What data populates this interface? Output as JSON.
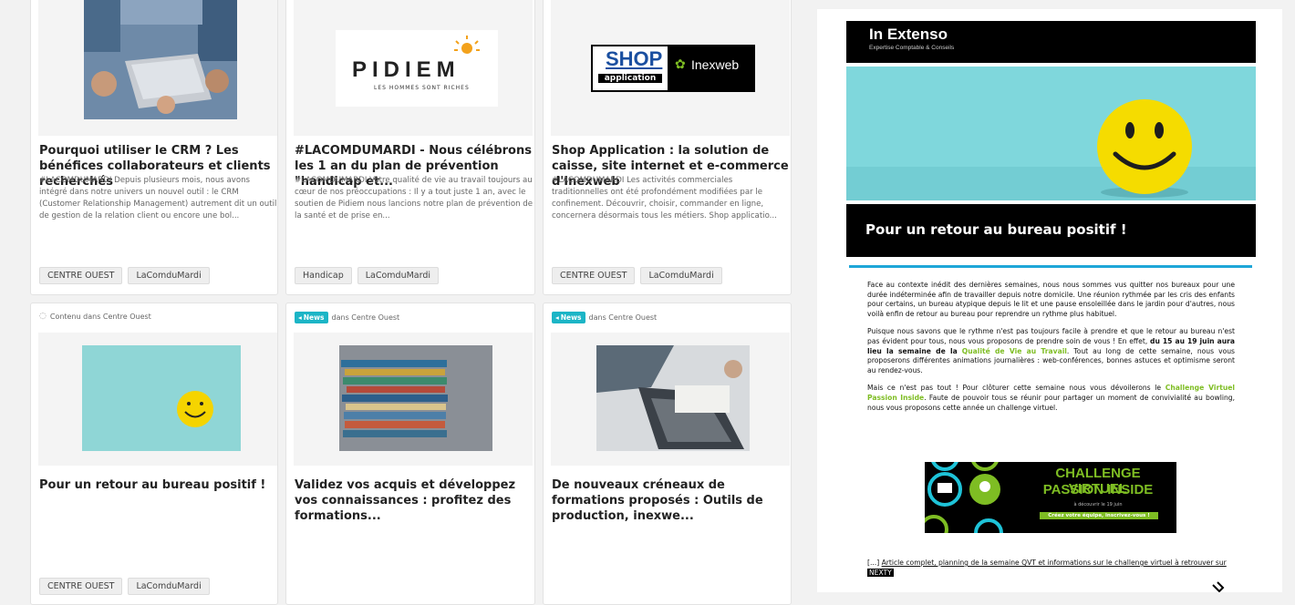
{
  "cards": [
    {
      "title": "Pourquoi utiliser le CRM ? Les bénéfices collaborateurs et clients recherchés",
      "excerpt": "#LACOMDUMARDI Depuis plusieurs mois, nous avons intégré dans notre univers un nouvel outil : le CRM (Customer Relationship Management) autrement dit un outil de gestion de la relation client ou encore une bol...",
      "tags": [
        "CENTRE OUEST",
        "LaComduMardi"
      ]
    },
    {
      "title": "#LACOMDUMARDI - Nous célébrons les 1 an du plan de prévention \"handicap et...",
      "excerpt": "#LACOMDUMARDI Votre qualité de vie au travail toujours au cœur de nos préoccupations : Il y a tout juste 1 an, avec le soutien de Pidiem nous lancions notre plan de prévention de la santé et de prise en...",
      "tags": [
        "Handicap",
        "LaComduMardi"
      ],
      "logo_text": "PIDIEM",
      "logo_subtext": "LES HOMMES SONT RICHES"
    },
    {
      "title": "Shop Application : la solution de caisse, site internet et e-commerce d'Inexweb",
      "excerpt": "#LACOMDUMARDI Les activités commerciales traditionnelles ont été profondément modifiées par le confinement. Découvrir, choisir, commander en ligne, concernera désormais tous les métiers. Shop applicatio...",
      "tags": [
        "CENTRE OUEST",
        "LaComduMardi"
      ],
      "logo_shop": "SHOP",
      "logo_application": "application",
      "logo_inexweb": "Inexweb"
    },
    {
      "meta": "Contenu dans Centre Ouest",
      "title": "Pour un retour au bureau positif !",
      "tags": [
        "CENTRE OUEST",
        "LaComduMardi"
      ]
    },
    {
      "badge": "News",
      "meta": "dans Centre Ouest",
      "title": "Validez vos acquis et développez vos connaissances : profitez des formations..."
    },
    {
      "badge": "News",
      "meta": "dans Centre Ouest",
      "title": "De nouveaux créneaux de formations proposés : Outils de production, inexwe..."
    }
  ],
  "newsletter": {
    "brand": "In Extenso",
    "tagline": "Expertise Comptable & Conseils",
    "title": "Pour un retour au bureau positif !",
    "p1": "Face au contexte inédit des dernières semaines, nous nous sommes vus quitter nos bureaux pour une durée indéterminée afin de travailler depuis notre domicile. Une réunion rythmée par les cris des enfants pour certains, un bureau atypique depuis le lit et une pause ensoleillée dans le jardin pour d'autres, nous voilà enfin de retour au bureau pour reprendre un rythme plus habituel.",
    "p2a": "Puisque nous savons que le rythme n'est pas toujours facile à prendre et que le retour au bureau n'est pas évident pour tous, nous vous proposons de prendre soin de vous ! En effet,",
    "p2b": "du 15 au 19 juin aura lieu la semaine de la",
    "p2c": "Qualité de Vie au Travail",
    "p2d": ". Tout au long de cette semaine, nous vous proposerons différentes animations journalières : web-conférences, bonnes astuces et optimisme seront au rendez-vous.",
    "p3a": "Mais ce n'est pas tout ! Pour clôturer cette semaine nous vous dévoilerons le",
    "p3b": "Challenge Virtuel Passion Inside",
    "p3c": ". Faute de pouvoir tous se réunir pour partager un moment de convivialité au bowling, nous vous proposons cette année un challenge virtuel.",
    "challenge_line1": "CHALLENGE VIRTUEL",
    "challenge_line2": "PASSION INSIDE",
    "challenge_date": "à découvrir le 19 juin",
    "challenge_cta": "Créez votre équipe, inscrivez-vous !",
    "footer_prefix": "[...]",
    "footer_link": "Article complet, planning de la semaine QVT et informations sur le challenge virtuel à retrouver sur",
    "footer_nexty": "NEXTY"
  }
}
